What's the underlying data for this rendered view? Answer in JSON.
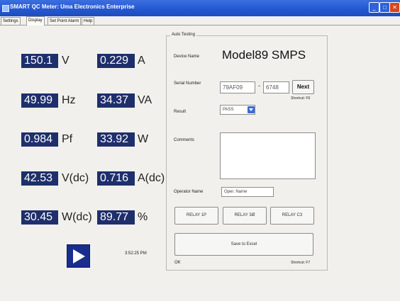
{
  "window": {
    "title": "SMART QC Meter: Uma Electronics Enterprise",
    "min": "_",
    "max": "□",
    "close": "✕"
  },
  "tabs": [
    {
      "label": "Settings"
    },
    {
      "label": "Display"
    },
    {
      "label": "Set Point Alarm"
    },
    {
      "label": "Help"
    }
  ],
  "readouts": [
    {
      "value": "150.1",
      "unit": "V"
    },
    {
      "value": "0.229",
      "unit": "A"
    },
    {
      "value": "49.99",
      "unit": "Hz"
    },
    {
      "value": "34.37",
      "unit": "VA"
    },
    {
      "value": "0.984",
      "unit": "Pf"
    },
    {
      "value": "33.92",
      "unit": "W"
    },
    {
      "value": "42.53",
      "unit": "V(dc)"
    },
    {
      "value": "0.716",
      "unit": "A(dc)"
    },
    {
      "value": "30.45",
      "unit": "W(dc)"
    },
    {
      "value": "89.77",
      "unit": "%"
    }
  ],
  "play_icon": "play-icon",
  "clock": "3:52:25 PM",
  "auto_testing": {
    "title": "Auto Testing",
    "device_label": "Device Name",
    "device_name": "Model89 SMPS",
    "serial_label": "Serial Number",
    "serial_prefix": "79AF09",
    "serial_dash": "-",
    "serial_number": "6748",
    "next_label": "Next",
    "shortcut_f6": "Shortcut: F6",
    "result_label": "Result",
    "result_value": "PASS",
    "comments_label": "Comments",
    "comments_value": "",
    "operator_label": "Operator Name",
    "operator_value": "Oper. Name",
    "relay_buttons": [
      "RELAY 1P",
      "RELAY 3Ø",
      "RELAY C3"
    ],
    "save_label": "Save to Excel",
    "status": "OK",
    "shortcut_f7": "Shortcut: F7"
  }
}
